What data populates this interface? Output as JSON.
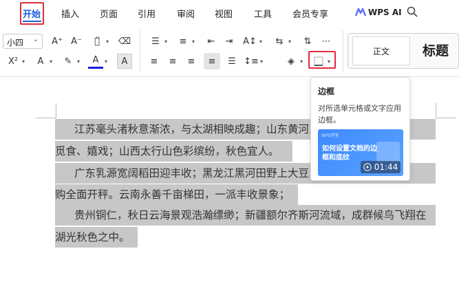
{
  "menu": {
    "tabs": [
      "开始",
      "插入",
      "页面",
      "引用",
      "审阅",
      "视图",
      "工具",
      "会员专享"
    ],
    "active_tab": "开始",
    "wps_ai_label": "WPS AI"
  },
  "toolbar": {
    "font_size_value": "小四",
    "styles": {
      "normal": "正文",
      "title": "标题"
    }
  },
  "tooltip": {
    "title": "边框",
    "description": "对所选单元格或文字应用边框。",
    "video": {
      "brand": "WPS学堂",
      "title": "如何设置文档的边框和底纹",
      "duration": "01:44"
    }
  },
  "document": {
    "lines": [
      "江苏毫头渚秋意渐浓，与太湖相映成趣；山东黄河……湿地",
      "觅食、嬉戏；山西太行山色彩缤纷，秋色宜人。",
      "广东乳源宽阔稻田迎丰收；黑龙江黑河田野上大豆……粮收",
      "购全面开秤。云南永善千亩梯田，一派丰收景象；",
      "贵州铜仁，秋日云海景观浩瀚缥缈；新疆额尔齐斯河流域，成群候鸟飞翔在",
      "湖光秋色之中。"
    ]
  },
  "colors": {
    "accent": "#1a5fe0",
    "highlight_border": "#e02a3a",
    "selection": "#c7c7c7"
  }
}
